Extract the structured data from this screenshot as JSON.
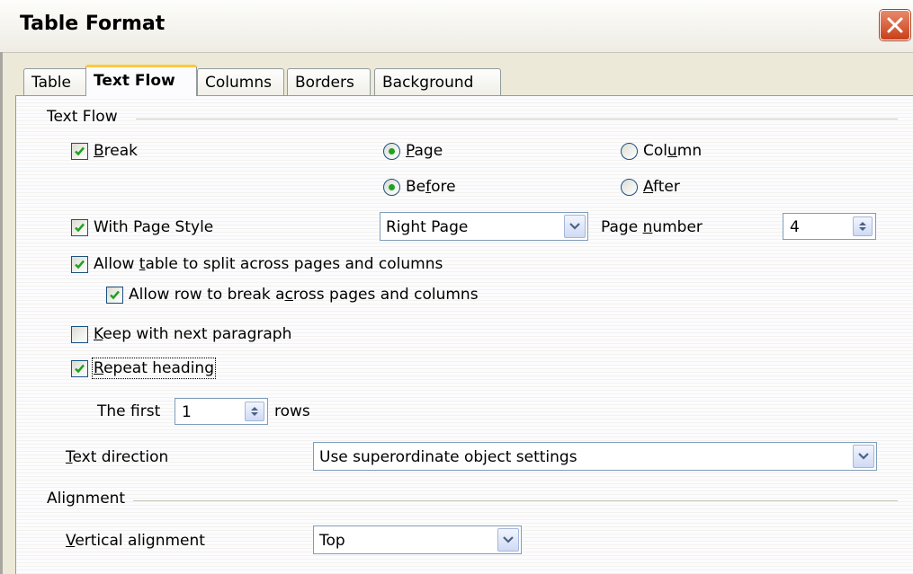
{
  "window": {
    "title": "Table Format"
  },
  "tabs": [
    {
      "label": "Table"
    },
    {
      "label": "Text Flow"
    },
    {
      "label": "Columns"
    },
    {
      "label": "Borders"
    },
    {
      "label": "Background"
    }
  ],
  "text_flow": {
    "section_label": "Text Flow",
    "break": {
      "label_mn": "B",
      "label_rest": "reak",
      "checked": true,
      "page": {
        "label_mn": "P",
        "label_rest": "age",
        "selected": true
      },
      "column": {
        "label_pre": "Col",
        "label_mn": "u",
        "label_post": "mn",
        "selected": false
      },
      "before": {
        "label_pre": "Be",
        "label_mn": "f",
        "label_post": "ore",
        "selected": true
      },
      "after": {
        "label_mn": "A",
        "label_rest": "fter",
        "selected": false
      }
    },
    "with_page_style": {
      "label": "With Page Style",
      "checked": true,
      "value": "Right Page",
      "page_number": {
        "label_pre": "Page ",
        "label_mn": "n",
        "label_post": "umber",
        "value": "4"
      }
    },
    "allow_split": {
      "label_pre": "Allow ",
      "label_mn": "t",
      "label_post": "able to split across pages and columns",
      "checked": true
    },
    "allow_row_break": {
      "label_pre": "Allow row to break a",
      "label_mn": "c",
      "label_post": "ross pages and columns",
      "checked": true
    },
    "keep_with_next": {
      "label_mn": "K",
      "label_rest": "eep with next paragraph",
      "checked": false
    },
    "repeat_heading": {
      "label_mn": "R",
      "label_rest": "epeat heading",
      "checked": true,
      "first_label": "The first",
      "first_value": "1",
      "rows_label": "rows"
    },
    "text_direction": {
      "label_mn": "T",
      "label_rest": "ext direction",
      "value": "Use superordinate object settings"
    }
  },
  "alignment": {
    "section_label": "Alignment",
    "vertical": {
      "label_mn": "V",
      "label_rest": "ertical alignment",
      "value": "Top"
    }
  }
}
